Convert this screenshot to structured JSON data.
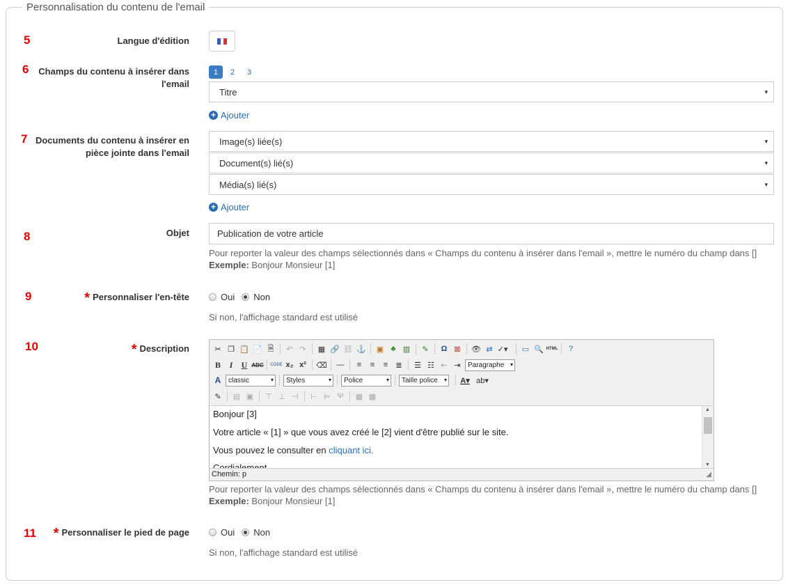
{
  "legend": "Personnalisation du contenu de l'email",
  "numbers": [
    "5",
    "6",
    "7",
    "8",
    "9",
    "10",
    "11"
  ],
  "language": {
    "label": "Langue d'édition",
    "flag_colors": [
      "#3a5bb5",
      "#ffffff",
      "#d9343a"
    ]
  },
  "fields": {
    "label": "Champs du contenu à insérer dans l'email",
    "pages": [
      "1",
      "2",
      "3"
    ],
    "active_page": "1",
    "selected": "Titre",
    "add_label": "Ajouter"
  },
  "documents": {
    "label": "Documents du contenu à insérer en pièce jointe dans l'email",
    "selects": [
      "Image(s) liée(s)",
      "Document(s) lié(s)",
      "Média(s) lié(s)"
    ],
    "add_label": "Ajouter"
  },
  "subject": {
    "label": "Objet",
    "value": "Publication de votre article",
    "help": "Pour reporter la valeur des champs sélectionnés dans « Champs du contenu à insérer dans l'email », mettre le numéro du champ dans []",
    "example_label": "Exemple:",
    "example_value": " Bonjour Monsieur [1]"
  },
  "header": {
    "label": "Personnaliser l'en-tête",
    "options": [
      "Oui",
      "Non"
    ],
    "selected": "Non",
    "help": "Si non, l'affichage standard est utilisé"
  },
  "description": {
    "label": "Description",
    "toolbar": {
      "format": "Paragraphe",
      "style_class": "classic",
      "styles": "Styles",
      "font": "Police",
      "font_size": "Taille police"
    },
    "content": {
      "line1": "Bonjour [3]",
      "line2": "Votre article « [1] » que vous avez créé le [2] vient d'être publié sur le site.",
      "line3_prefix": "Vous pouvez le consulter en ",
      "line3_link": "cliquant ici.",
      "line4": "Cordialement"
    },
    "path": "Chemin: p",
    "help": "Pour reporter la valeur des champs sélectionnés dans « Champs du contenu à insérer dans l'email », mettre le numéro du champ dans []",
    "example_label": "Exemple:",
    "example_value": " Bonjour Monsieur [1]"
  },
  "footer": {
    "label": "Personnaliser le pied de page",
    "options": [
      "Oui",
      "Non"
    ],
    "selected": "Non",
    "help": "Si non, l'affichage standard est utilisé"
  },
  "required_mark": "*",
  "caret": "▾",
  "plus": "+"
}
